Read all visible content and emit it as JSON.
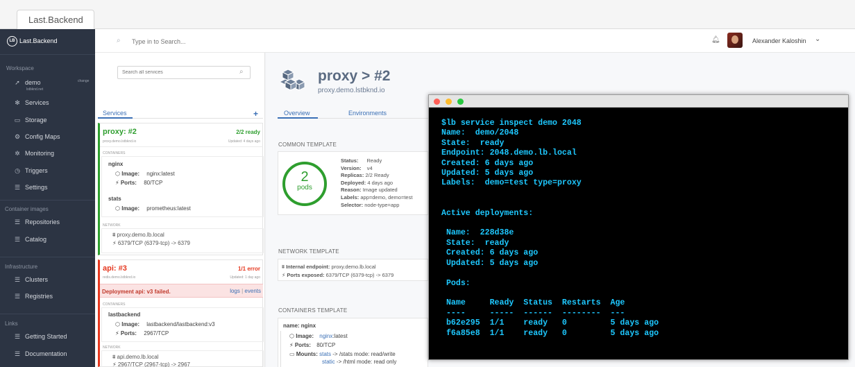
{
  "browser": {
    "tab_title": "Last.Backend"
  },
  "sidebar": {
    "logo_badge": "LB",
    "logo_text": "Last.Backend",
    "workspace_head": "Workspace",
    "workspace_name": "demo",
    "workspace_sub": "lstbknd.net",
    "workspace_change": "change",
    "workspace_items": [
      "Services",
      "Storage",
      "Config Maps",
      "Monitoring",
      "Triggers",
      "Settings"
    ],
    "images_head": "Container images",
    "images_items": [
      "Repositories",
      "Catalog"
    ],
    "infra_head": "Infrastructure",
    "infra_items": [
      "Clusters",
      "Registries"
    ],
    "links_head": "Links",
    "links_items": [
      "Getting Started",
      "Documentation"
    ]
  },
  "topbar": {
    "search_placeholder": "Type in to Search...",
    "user_name": "Alexander Kaloshin"
  },
  "services": {
    "search_placeholder": "Search all services",
    "tab_label": "Services",
    "add": "+",
    "proxy": {
      "name": "proxy: #2",
      "status": "2/2 ready",
      "sub": "proxy.demo.lstbknd.io",
      "updated": "Updated: 4 days ago",
      "containers_head": "CONTAINERS",
      "c1_name": "nginx",
      "c1_image_label": "Image:",
      "c1_image": "nginx:latest",
      "c1_ports_label": "Ports:",
      "c1_ports": "80/TCP",
      "c2_name": "stats",
      "c2_image_label": "Image:",
      "c2_image": "prometheus:latest",
      "network_head": "NETWORK",
      "net_host": "proxy.demo.lb.local",
      "net_ports": "6379/TCP (6379-tcp) -> 6379"
    },
    "api": {
      "name": "api: #3",
      "status": "1/1 error",
      "sub": "redis.demo.lstbknd.io",
      "updated": "Updated: 1 day ago",
      "error": "Deployment api: v3 failed.",
      "logs": "logs",
      "sep": "|",
      "events": "events",
      "containers_head": "CONTAINERS",
      "c1_name": "lastbackend",
      "c1_image_label": "Image:",
      "c1_image": "lastbackend/lastbackend:v3",
      "c1_ports_label": "Ports:",
      "c1_ports": "2967/TCP",
      "network_head": "NETWORK",
      "net_host": "api.demo.lb.local",
      "net_ports": "2967/TCP (2967-tcp) -> 2967"
    }
  },
  "detail": {
    "title": "proxy > #2",
    "subtitle": "proxy.demo.lstbknd.io",
    "tabs": [
      "Overview",
      "Environments"
    ],
    "common_head": "COMMON TEMPLATE",
    "pods_count": "2",
    "pods_label": "pods",
    "status_rows": [
      {
        "k": "Status:",
        "v": "Ready"
      },
      {
        "k": "Version:",
        "v": "v4"
      },
      {
        "k": "Replicas:",
        "v": "2/2 Ready"
      },
      {
        "k": "Deployed:",
        "v": "4 days ago"
      },
      {
        "k": "Reason:",
        "v": "Image updated"
      },
      {
        "k": "Labels:",
        "v": "app=demo, demo=test"
      },
      {
        "k": "Selector:",
        "v": "node-type=app"
      }
    ],
    "network_head": "NETWORK TEMPLATE",
    "net_endpoint_label": "Internal endpoint:",
    "net_endpoint": "proxy.demo.lb.local",
    "net_ports_label": "Ports exposed:",
    "net_ports": "6379/TCP (6379-tcp) -> 6379",
    "containers_head": "CONTAINERS TEMPLATE",
    "ct_name": "name: nginx",
    "ct_image_label": "Image:",
    "ct_image": "nginx",
    "ct_image_suffix": ":latest",
    "ct_ports_label": "Ports:",
    "ct_ports": "80/TCP",
    "ct_mounts_label": "Mounts:",
    "ct_mount1_name": "stats",
    "ct_mount1_rest": "-> /stats  mode: read/write",
    "ct_mount2_name": "static",
    "ct_mount2_rest": "-> /html  mode: read only"
  },
  "terminal": {
    "lines": [
      "$lb service inspect demo 2048",
      "Name:  demo/2048",
      "State:  ready",
      "Endpoint: 2048.demo.lb.local",
      "Created: 6 days ago",
      "Updated: 5 days ago",
      "Labels:  demo=test type=proxy",
      "",
      "",
      "Active deployments:",
      "",
      " Name:  228d38e",
      " State:  ready",
      " Created: 6 days ago",
      " Updated: 5 days ago",
      "",
      " Pods:",
      "",
      " Name     Ready  Status  Restarts  Age",
      " ----     -----  ------  --------  ---",
      " b62e295  1/1    ready   0         5 days ago",
      " f6a85e8  1/1    ready   0         5 days ago"
    ]
  },
  "colors": {
    "sidebar_bg": "#2c3443",
    "ok": "#2e9e2e",
    "error": "#e5371e",
    "accent": "#3a6fb5",
    "terminal_text": "#1ec8ff"
  }
}
